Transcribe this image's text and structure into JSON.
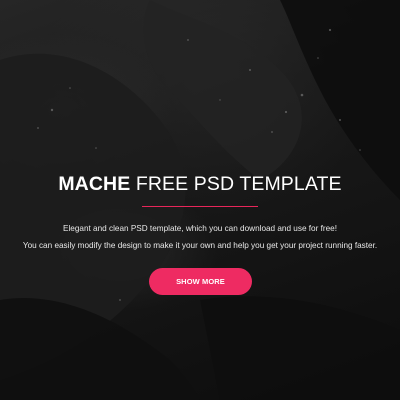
{
  "hero": {
    "title_strong": "MACHE",
    "title_light": " FREE PSD TEMPLATE",
    "description_line1": "Elegant and clean PSD template, which you can download and use for free!",
    "description_line2": "You can easily modify the design to make it your own and help you get your project running faster.",
    "button_label": "SHOW MORE"
  },
  "colors": {
    "accent": "#ee2b62",
    "background": "#111111",
    "text": "#ffffff"
  }
}
